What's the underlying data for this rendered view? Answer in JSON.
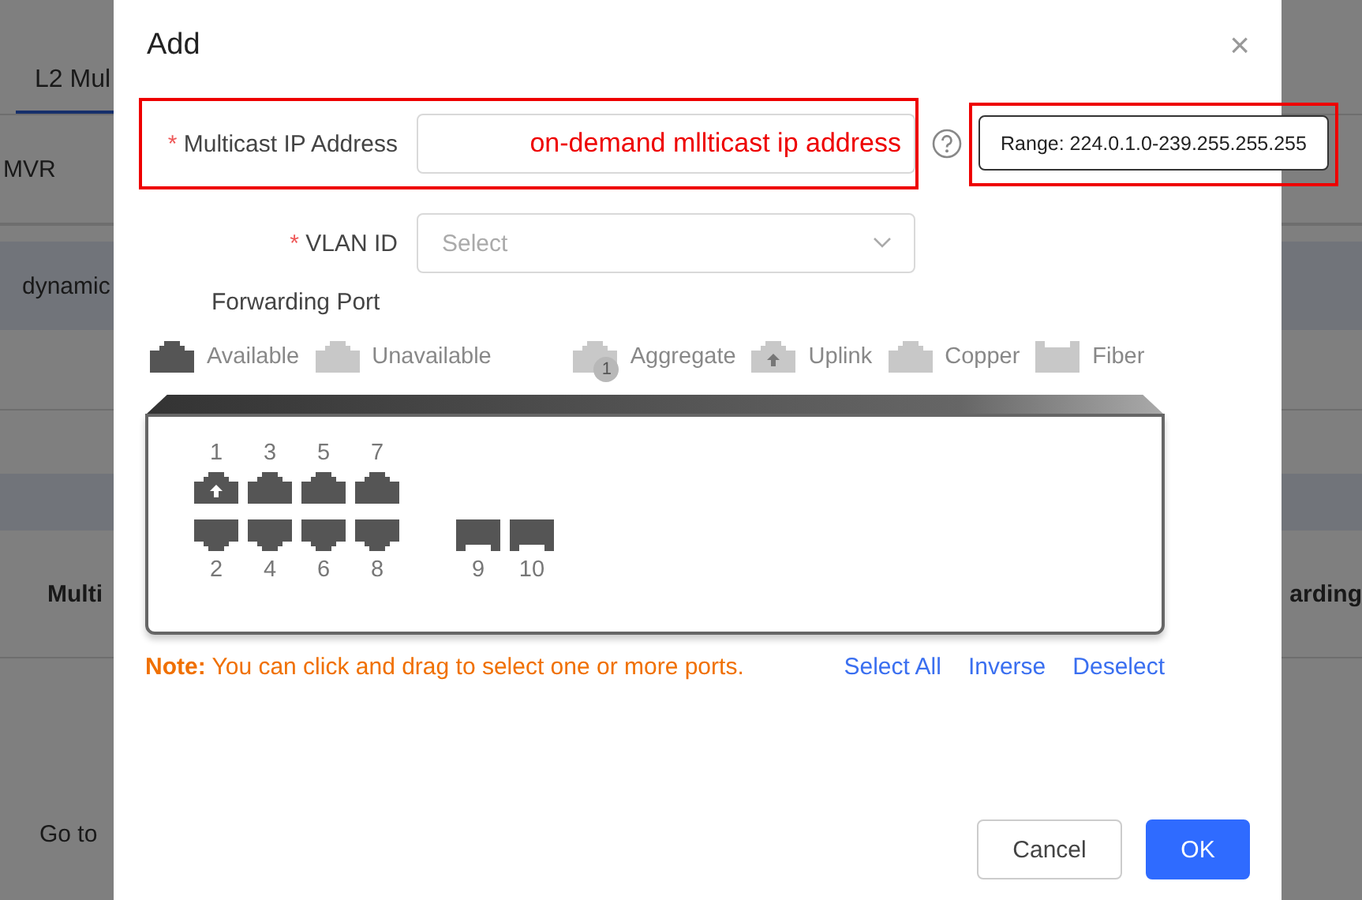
{
  "background": {
    "tab": "L2 Mul",
    "subtab": "MVR",
    "banner_text": "dynamic",
    "column_1": "Multi",
    "column_2": "arding",
    "row_text": "Go to"
  },
  "dialog": {
    "title": "Add",
    "close": "×",
    "fields": [
      {
        "kind": "input",
        "mark": "*",
        "label": "Multicast IP Address",
        "value": "on-demand mllticast ip address",
        "highlighted": true,
        "help": true,
        "tooltip": {
          "text": "Range: 224.0.1.0-239.255.255.255",
          "highlighted": true
        }
      },
      {
        "kind": "select",
        "mark": "*",
        "label": "VLAN ID",
        "placeholder": "Select",
        "highlighted": false,
        "help": false
      }
    ],
    "forwarding_port": {
      "label": "Forwarding Port",
      "legend": [
        {
          "kind": "available",
          "label": "Available"
        },
        {
          "kind": "unavailable",
          "label": "Unavailable"
        },
        {
          "kind": "aggregate",
          "label": "Aggregate",
          "badge": "1"
        },
        {
          "kind": "uplink",
          "label": "Uplink"
        },
        {
          "kind": "copper",
          "label": "Copper"
        },
        {
          "kind": "fiber",
          "label": "Fiber"
        }
      ],
      "top_ports": [
        {
          "label": "1",
          "kind": "copper",
          "uplink": true,
          "available": true
        },
        {
          "label": "3",
          "kind": "copper",
          "uplink": false,
          "available": true
        },
        {
          "label": "5",
          "kind": "copper",
          "uplink": false,
          "available": true
        },
        {
          "label": "7",
          "kind": "copper",
          "uplink": false,
          "available": true
        }
      ],
      "bottom_ports": [
        {
          "label": "2",
          "kind": "copper",
          "uplink": false,
          "available": true
        },
        {
          "label": "4",
          "kind": "copper",
          "uplink": false,
          "available": true
        },
        {
          "label": "6",
          "kind": "copper",
          "uplink": false,
          "available": true
        },
        {
          "label": "8",
          "kind": "copper",
          "uplink": false,
          "available": true
        },
        {
          "label": "9",
          "kind": "fiber",
          "uplink": false,
          "available": true
        },
        {
          "label": "10",
          "kind": "fiber",
          "uplink": false,
          "available": true
        }
      ]
    },
    "note": {
      "label": "Note:",
      "text": "You can click and drag to select one or more ports."
    },
    "actions": [
      "Select All",
      "Inverse",
      "Deselect"
    ],
    "buttons": [
      {
        "label": "Cancel",
        "kind": "secondary"
      },
      {
        "label": "OK",
        "kind": "primary"
      }
    ]
  }
}
